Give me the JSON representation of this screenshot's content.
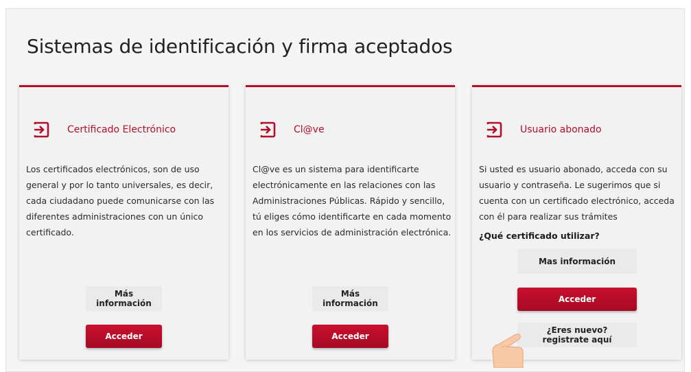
{
  "page": {
    "title": "Sistemas de identificación y firma aceptados"
  },
  "cards": [
    {
      "icon": "enter-icon",
      "title": "Certificado Electrónico",
      "text": "Los certificados electrónicos, son de uso general y por lo tanto universales, es decir, cada ciudadano puede comunicarse con las diferentes administraciones con un único certificado.",
      "info_label": "Más información",
      "primary_label": "Acceder"
    },
    {
      "icon": "enter-icon",
      "title": "Cl@ve",
      "text": "Cl@ve es un sistema para identificarte electrónicamente en las relaciones con las Administraciones Públicas. Rápido y sencillo, tú eliges cómo identificarte en cada momento en los servicios de administración electrónica.",
      "info_label": "Más información",
      "primary_label": "Acceder"
    },
    {
      "icon": "enter-icon",
      "title": "Usuario abonado",
      "text": "Si usted es usuario abonado, acceda con su usuario y contraseña. Le sugerimos que si cuenta con un certificado electrónico, acceda con él para realizar sus trámites",
      "subhead": "¿Qué certificado utilizar?",
      "info_label": "Mas información",
      "primary_label": "Acceder",
      "register_label": "¿Eres nuevo? registrate aquí"
    }
  ],
  "colors": {
    "accent": "#b30e2a",
    "card_bg": "#f2f2f2",
    "page_bg": "#f5f5f5"
  },
  "overlay": {
    "cursor_icon": "hand-pointer-icon"
  }
}
